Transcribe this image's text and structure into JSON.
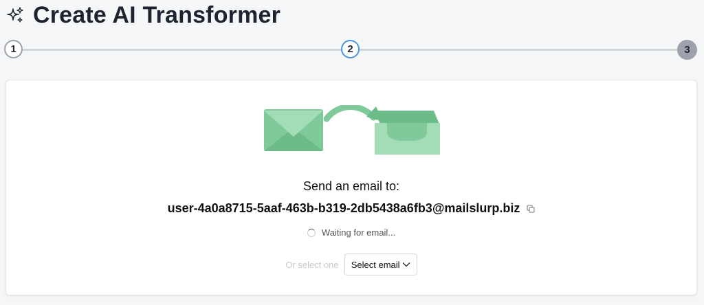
{
  "page": {
    "title": "Create AI Transformer"
  },
  "stepper": {
    "steps": [
      {
        "label": "1",
        "state": "complete"
      },
      {
        "label": "2",
        "state": "active"
      },
      {
        "label": "3",
        "state": "pending"
      }
    ]
  },
  "card": {
    "send_label": "Send an email to:",
    "email_address": "user-4a0a8715-5aaf-463b-b319-2db5438a6fb3@mailslurp.biz",
    "waiting_text": "Waiting for email...",
    "or_select_label": "Or select one",
    "select_button_label": "Select email"
  },
  "icons": {
    "title": "sparkles-icon",
    "copy": "copy-icon",
    "spinner": "spinner-icon",
    "select": "chevron-down-icon",
    "illustration": [
      "envelope-icon",
      "curved-arrow-icon",
      "inbox-tray-icon"
    ]
  },
  "colors": {
    "active_step_border": "#4a90e2",
    "pending_step_fill": "#9ca1ab",
    "illustration_green": "#7fcc98",
    "title_text": "#1c2430"
  }
}
